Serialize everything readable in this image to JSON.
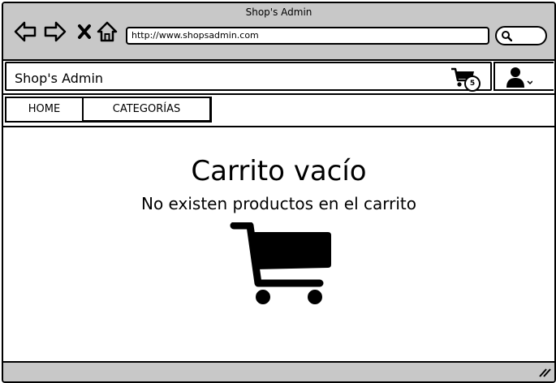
{
  "window": {
    "title": "Shop's Admin"
  },
  "browser": {
    "url": "http://www.shopsadmin.com",
    "icons": [
      "back-arrow-icon",
      "forward-arrow-icon",
      "close-x-icon",
      "home-icon",
      "search-icon"
    ]
  },
  "header": {
    "title": "Shop's Admin",
    "cart_count": "5",
    "icons": [
      "shopping-cart-icon",
      "user-icon",
      "chevron-down-icon"
    ]
  },
  "tabs": [
    {
      "label": "HOME"
    },
    {
      "label": "CATEGORÍAS"
    }
  ],
  "empty_state": {
    "title": "Carrito vacío",
    "message": "No existen productos en el carrito",
    "icon": "shopping-cart-icon"
  },
  "colors": {
    "chrome": "#c8c8c8",
    "ink": "#000000",
    "background": "#ffffff"
  }
}
